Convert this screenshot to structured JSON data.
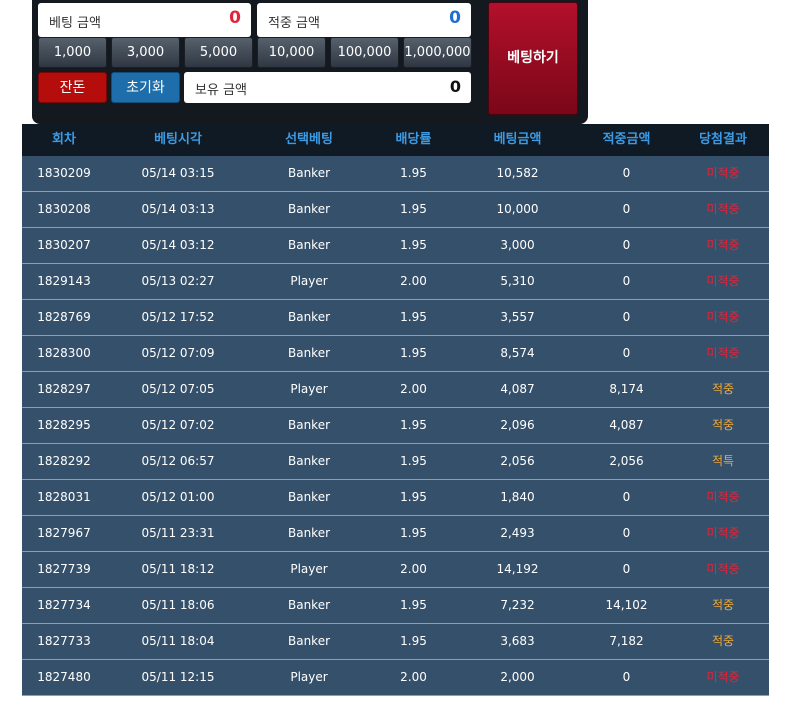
{
  "bet_panel": {
    "bet_amount_label": "베팅 금액",
    "bet_amount_value": "0",
    "win_amount_label": "적중 금액",
    "win_amount_value": "0",
    "chips": [
      "1,000",
      "3,000",
      "5,000",
      "10,000",
      "100,000",
      "1,000,000"
    ],
    "balance_button": "잔돈",
    "reset_button": "초기화",
    "holding_label": "보유 금액",
    "holding_value": "0",
    "bet_button": "베팅하기"
  },
  "colors": {
    "bet_value": "#e0253a",
    "win_value": "#1f6fd1",
    "balance_button": "#b50c0c",
    "reset_button": "#1e6eab",
    "lose_text": "#e0253a",
    "win_text": "#f0a93a"
  },
  "history": {
    "headers": [
      "회차",
      "베팅시각",
      "선택베팅",
      "배당률",
      "베팅금액",
      "적중금액",
      "당첨결과"
    ],
    "rows": [
      [
        "1830209",
        "05/14 03:15",
        "Banker",
        "1.95",
        "10,582",
        "0",
        "미적중"
      ],
      [
        "1830208",
        "05/14 03:13",
        "Banker",
        "1.95",
        "10,000",
        "0",
        "미적중"
      ],
      [
        "1830207",
        "05/14 03:12",
        "Banker",
        "1.95",
        "3,000",
        "0",
        "미적중"
      ],
      [
        "1829143",
        "05/13 02:27",
        "Player",
        "2.00",
        "5,310",
        "0",
        "미적중"
      ],
      [
        "1828769",
        "05/12 17:52",
        "Banker",
        "1.95",
        "3,557",
        "0",
        "미적중"
      ],
      [
        "1828300",
        "05/12 07:09",
        "Banker",
        "1.95",
        "8,574",
        "0",
        "미적중"
      ],
      [
        "1828297",
        "05/12 07:05",
        "Player",
        "2.00",
        "4,087",
        "8,174",
        "적중"
      ],
      [
        "1828295",
        "05/12 07:02",
        "Banker",
        "1.95",
        "2,096",
        "4,087",
        "적중"
      ],
      [
        "1828292",
        "05/12 06:57",
        "Banker",
        "1.95",
        "2,056",
        "2,056",
        "적특"
      ],
      [
        "1828031",
        "05/12 01:00",
        "Banker",
        "1.95",
        "1,840",
        "0",
        "미적중"
      ],
      [
        "1827967",
        "05/11 23:31",
        "Banker",
        "1.95",
        "2,493",
        "0",
        "미적중"
      ],
      [
        "1827739",
        "05/11 18:12",
        "Player",
        "2.00",
        "14,192",
        "0",
        "미적중"
      ],
      [
        "1827734",
        "05/11 18:06",
        "Banker",
        "1.95",
        "7,232",
        "14,102",
        "적중"
      ],
      [
        "1827733",
        "05/11 18:04",
        "Banker",
        "1.95",
        "3,683",
        "7,182",
        "적중"
      ],
      [
        "1827480",
        "05/11 12:15",
        "Player",
        "2.00",
        "2,000",
        "0",
        "미적중"
      ]
    ]
  }
}
